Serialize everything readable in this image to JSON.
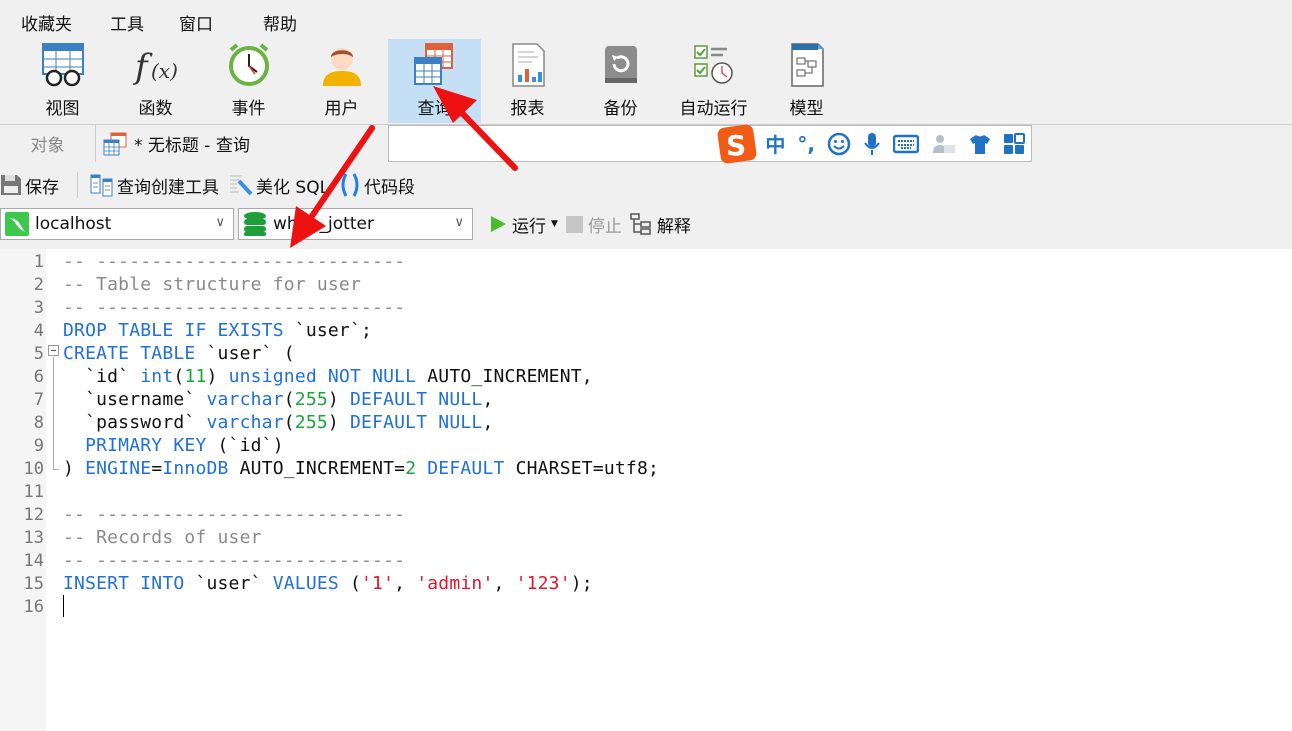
{
  "menu": [
    "收藏夹",
    "工具",
    "窗口",
    "帮助"
  ],
  "ribbon": [
    {
      "label": "视图",
      "icon": "view-icon"
    },
    {
      "label": "函数",
      "icon": "function-icon"
    },
    {
      "label": "事件",
      "icon": "event-clock-icon"
    },
    {
      "label": "用户",
      "icon": "user-icon"
    },
    {
      "label": "查询",
      "icon": "query-icon",
      "active": true
    },
    {
      "label": "报表",
      "icon": "report-icon"
    },
    {
      "label": "备份",
      "icon": "backup-icon"
    },
    {
      "label": "自动运行",
      "icon": "schedule-icon"
    },
    {
      "label": "模型",
      "icon": "model-icon"
    }
  ],
  "tabs": {
    "objects": "对象",
    "query": "* 无标题 - 查询"
  },
  "ime": {
    "lang": "中",
    "punct": "°,"
  },
  "toolbar": {
    "save": "保存",
    "query_builder": "查询创建工具",
    "beautify": "美化 SQL",
    "snippet": "代码段",
    "run": "运行",
    "stop": "停止",
    "explain": "解释"
  },
  "connection": "localhost",
  "database": "white_jotter",
  "colors": {
    "keyword": "#1f6fdc",
    "comment": "#8a8a8a",
    "number": "#1aa53a",
    "string": "#e8142a",
    "active_ribbon": "#c5dff5",
    "arrow": "#ee1111"
  },
  "code": [
    [
      [
        "c",
        "-- ----------------------------"
      ]
    ],
    [
      [
        "c",
        "-- Table structure for user"
      ]
    ],
    [
      [
        "c",
        "-- ----------------------------"
      ]
    ],
    [
      [
        "k",
        "DROP TABLE IF EXISTS"
      ],
      [
        "p",
        " `user`;"
      ]
    ],
    [
      [
        "k",
        "CREATE TABLE"
      ],
      [
        "p",
        " `user` ("
      ]
    ],
    [
      [
        "p",
        "  `id` "
      ],
      [
        "k",
        "int"
      ],
      [
        "p",
        "("
      ],
      [
        "n",
        "11"
      ],
      [
        "p",
        ") "
      ],
      [
        "k",
        "unsigned NOT NULL"
      ],
      [
        "p",
        " AUTO_INCREMENT,"
      ]
    ],
    [
      [
        "p",
        "  `username` "
      ],
      [
        "k",
        "varchar"
      ],
      [
        "p",
        "("
      ],
      [
        "n",
        "255"
      ],
      [
        "p",
        ") "
      ],
      [
        "k",
        "DEFAULT NULL"
      ],
      [
        "p",
        ","
      ]
    ],
    [
      [
        "p",
        "  `password` "
      ],
      [
        "k",
        "varchar"
      ],
      [
        "p",
        "("
      ],
      [
        "n",
        "255"
      ],
      [
        "p",
        ") "
      ],
      [
        "k",
        "DEFAULT NULL"
      ],
      [
        "p",
        ","
      ]
    ],
    [
      [
        "k",
        "  PRIMARY KEY"
      ],
      [
        "p",
        " (`id`)"
      ]
    ],
    [
      [
        "p",
        ") "
      ],
      [
        "k",
        "ENGINE"
      ],
      [
        "p",
        "="
      ],
      [
        "k",
        "InnoDB"
      ],
      [
        "p",
        " AUTO_INCREMENT="
      ],
      [
        "n",
        "2"
      ],
      [
        "k",
        " DEFAULT"
      ],
      [
        "p",
        " CHARSET=utf8;"
      ]
    ],
    [],
    [
      [
        "c",
        "-- ----------------------------"
      ]
    ],
    [
      [
        "c",
        "-- Records of user"
      ]
    ],
    [
      [
        "c",
        "-- ----------------------------"
      ]
    ],
    [
      [
        "k",
        "INSERT INTO"
      ],
      [
        "p",
        " `user` "
      ],
      [
        "k",
        "VALUES"
      ],
      [
        "p",
        " ("
      ],
      [
        "s",
        "'1'"
      ],
      [
        "p",
        ", "
      ],
      [
        "s",
        "'admin'"
      ],
      [
        "p",
        ", "
      ],
      [
        "s",
        "'123'"
      ],
      [
        "p",
        ");"
      ]
    ],
    []
  ]
}
